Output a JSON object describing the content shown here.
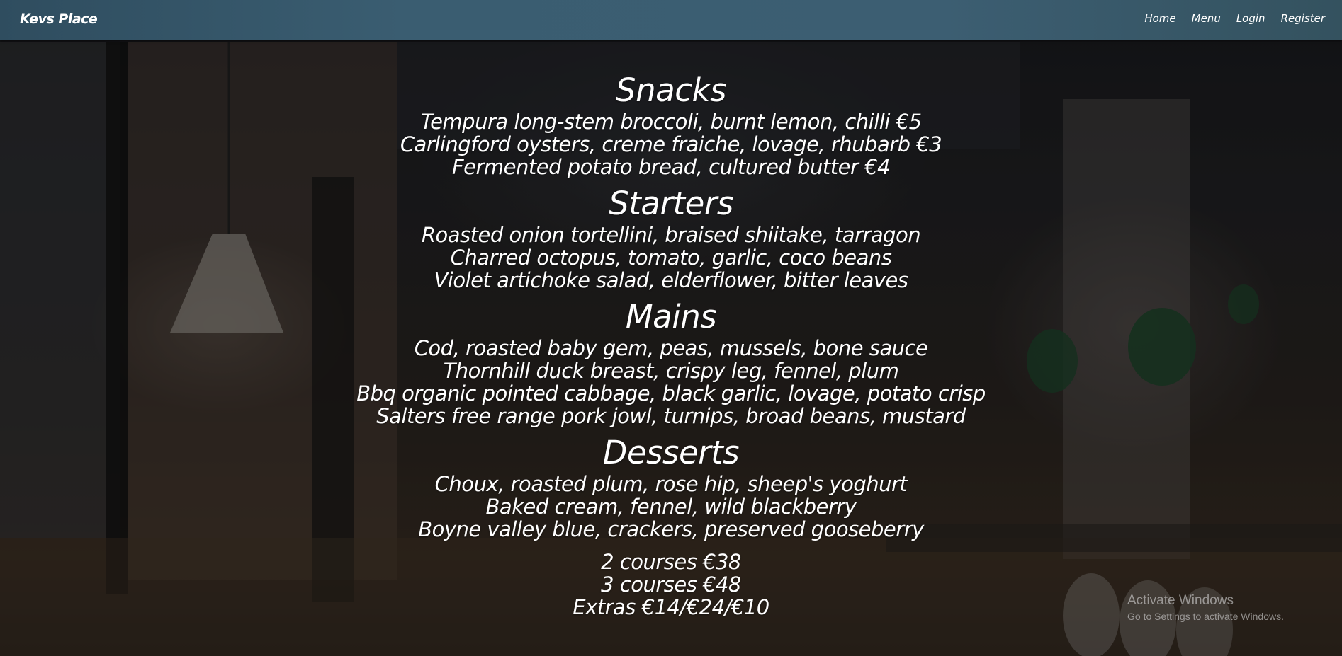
{
  "navbar": {
    "brand": "Kevs Place",
    "links": [
      {
        "label": "Home"
      },
      {
        "label": "Menu"
      },
      {
        "label": "Login"
      },
      {
        "label": "Register"
      }
    ]
  },
  "menu": {
    "sections": [
      {
        "title": "Snacks",
        "items": [
          "Tempura long-stem broccoli, burnt lemon, chilli €5",
          "Carlingford oysters, creme fraiche, lovage, rhubarb €3",
          "Fermented potato bread, cultured butter €4"
        ]
      },
      {
        "title": "Starters",
        "items": [
          "Roasted onion tortellini, braised shiitake, tarragon",
          "Charred octopus, tomato, garlic, coco beans",
          "Violet artichoke salad, elderflower, bitter leaves"
        ]
      },
      {
        "title": "Mains",
        "items": [
          "Cod, roasted baby gem, peas, mussels, bone sauce",
          "Thornhill duck breast, crispy leg, fennel, plum",
          "Bbq organic pointed cabbage, black garlic, lovage, potato crisp",
          "Salters free range pork jowl, turnips, broad beans, mustard"
        ]
      },
      {
        "title": "Desserts",
        "items": [
          "Choux, roasted plum, rose hip, sheep's yoghurt",
          "Baked cream, fennel, wild blackberry",
          "Boyne valley blue, crackers, preserved gooseberry"
        ]
      }
    ],
    "pricing": [
      "2 courses €38",
      "3 courses €48",
      "Extras €14/€24/€10"
    ]
  },
  "watermark": {
    "title": "Activate Windows",
    "subtitle": "Go to Settings to activate Windows."
  },
  "colors": {
    "navbar": "#3a5d71",
    "text": "#ffffff"
  }
}
